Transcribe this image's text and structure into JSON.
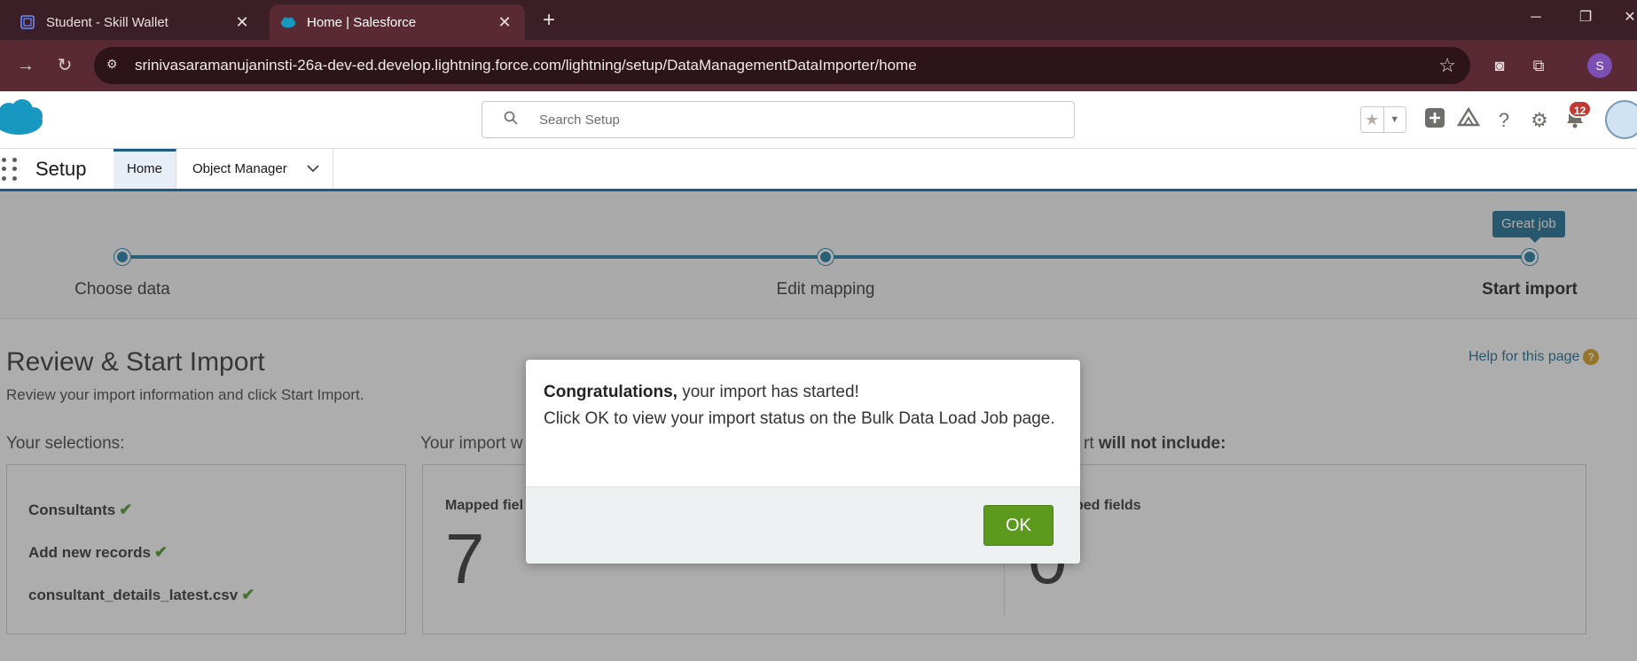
{
  "browser": {
    "tabs": [
      {
        "title": "Student - Skill Wallet",
        "icon": "skill-wallet-favicon"
      },
      {
        "title": "Home | Salesforce",
        "icon": "salesforce-favicon"
      }
    ],
    "new_tab_icon": "plus-icon",
    "url": "srinivasaramanujaninsti-26a-dev-ed.develop.lightning.force.com/lightning/setup/DataManagementDataImporter/home",
    "profile_initial": "S",
    "colors": {
      "tab_strip": "#3a1f26",
      "toolbar": "#5a2a34",
      "profile": "#7b4fb3"
    }
  },
  "header": {
    "search_placeholder": "Search Setup",
    "notification_count": "12",
    "icons": [
      "favorites-star-icon",
      "favorites-dropdown-icon",
      "global-actions-plus-icon",
      "trailhead-icon",
      "help-icon",
      "setup-gear-icon",
      "notifications-bell-icon",
      "user-avatar"
    ],
    "badge_color": "#c23934"
  },
  "nav": {
    "app_title": "Setup",
    "tabs": [
      {
        "label": "Home",
        "active": true
      },
      {
        "label": "Object Manager",
        "active": false
      }
    ]
  },
  "wizard": {
    "steps": [
      {
        "label": "Choose data",
        "current": false
      },
      {
        "label": "Edit mapping",
        "current": false
      },
      {
        "label": "Start import",
        "current": true
      }
    ],
    "tooltip": "Great job",
    "track_color": "#1b7aa4"
  },
  "page": {
    "title": "Review & Start Import",
    "subtitle": "Review your import information and click Start Import.",
    "help_link": "Help for this page",
    "selections_heading": "Your selections:",
    "import_will_heading": "Your import w",
    "will_not_heading_prefix": "rt",
    "will_not_heading_bold": "will not include:",
    "selections": [
      "Consultants",
      "Add new records",
      "consultant_details_latest.csv"
    ],
    "mapped_fields_label": "Mapped fiel",
    "mapped_fields_value": "7",
    "unmapped_fields_label": "ped fields",
    "unmapped_fields_value": "0"
  },
  "modal": {
    "message_bold": "Congratulations,",
    "message_rest": " your import has started!",
    "message_line2": "Click OK to view your import status on the Bulk Data Load Job page.",
    "ok_label": "OK",
    "ok_color": "#5c9a1e"
  }
}
